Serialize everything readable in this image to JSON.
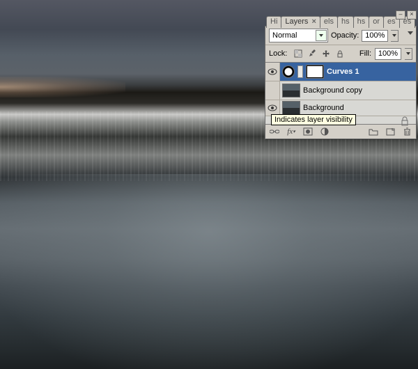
{
  "tabs": {
    "partial_left": "Hi",
    "active": "Layers",
    "active_x": "×",
    "frags": [
      "els",
      "hs",
      "hs",
      "or",
      "es",
      "es"
    ]
  },
  "win_controls": {
    "min": "–",
    "close": "×"
  },
  "blend_mode": {
    "value": "Normal"
  },
  "opacity": {
    "label": "Opacity:",
    "value": "100%"
  },
  "lock": {
    "label": "Lock:",
    "icons": [
      "transparency-lock-icon",
      "paint-lock-icon",
      "move-lock-icon",
      "full-lock-icon"
    ]
  },
  "fill": {
    "label": "Fill:",
    "value": "100%"
  },
  "layers": [
    {
      "name": "Curves 1",
      "selected": true,
      "visible": true,
      "type": "adjustment-curves"
    },
    {
      "name": "Background copy",
      "selected": false,
      "visible": false,
      "type": "pixel"
    },
    {
      "name": "Background",
      "selected": false,
      "visible": true,
      "type": "background-locked"
    }
  ],
  "tooltip": "Indicates layer visibility",
  "footer_icons": [
    "link-icon",
    "fx-icon",
    "mask-icon",
    "adjustment-icon",
    "group-icon",
    "new-icon",
    "trash-icon"
  ]
}
